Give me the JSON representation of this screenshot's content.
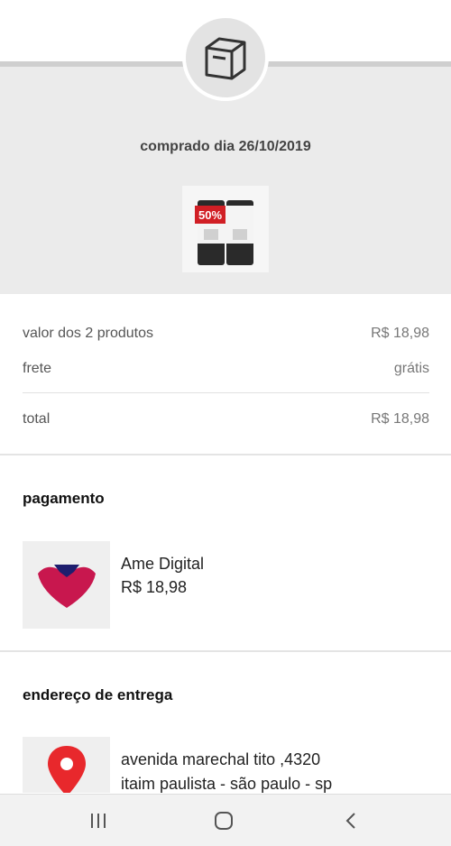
{
  "order": {
    "purchase_date_label": "comprado dia 26/10/2019"
  },
  "summary": {
    "products_label": "valor dos 2 produtos",
    "products_value": "R$ 18,98",
    "shipping_label": "frete",
    "shipping_value": "grátis",
    "total_label": "total",
    "total_value": "R$ 18,98"
  },
  "payment": {
    "title": "pagamento",
    "method": "Ame Digital",
    "amount": "R$ 18,98",
    "icon": "ame-digital-logo"
  },
  "delivery": {
    "title": "endereço de entrega",
    "address_line1": "avenida marechal tito ,4320",
    "address_line2": "itaim paulista - são paulo - sp",
    "icon": "location-pin-icon"
  },
  "product_thumbnail": {
    "badge_text": "50%"
  },
  "colors": {
    "hero_background": "#ebebeb",
    "ame_red": "#c8174e",
    "ame_navy": "#1e1e6e",
    "pin_red": "#e8282c"
  }
}
